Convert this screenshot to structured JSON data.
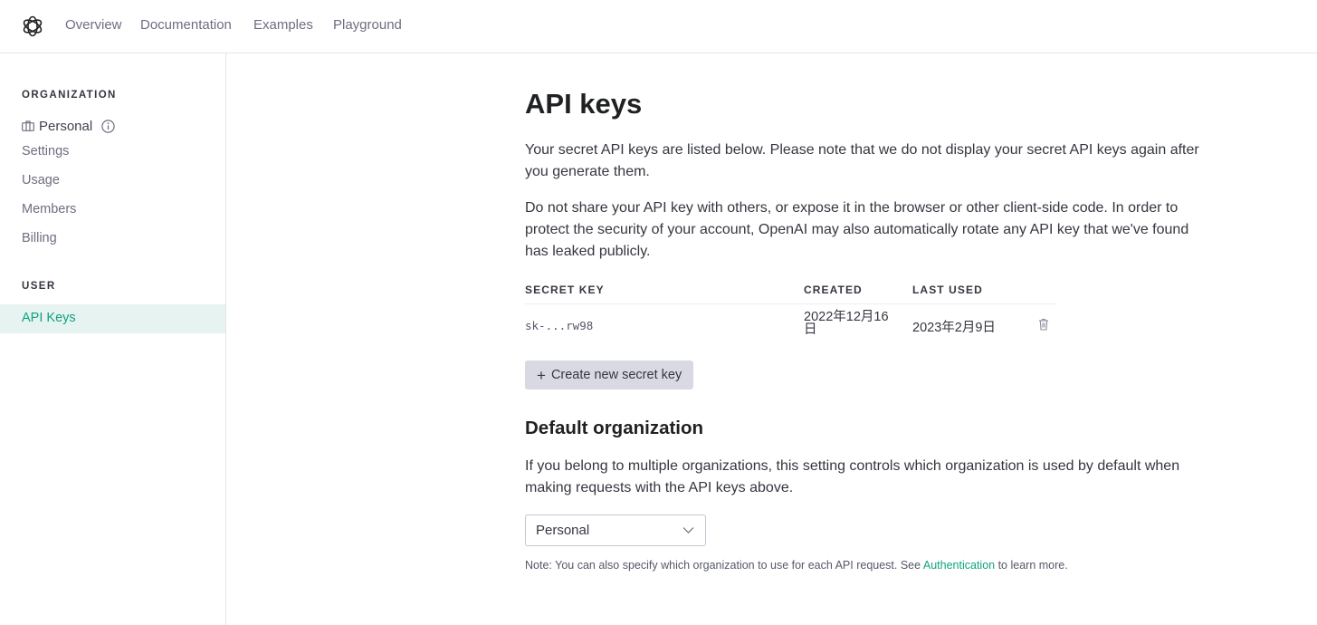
{
  "nav": {
    "links": [
      "Overview",
      "Documentation",
      "Examples",
      "Playground"
    ]
  },
  "sidebar": {
    "organization_title": "ORGANIZATION",
    "org_name": "Personal",
    "org_items": [
      "Settings",
      "Usage",
      "Members",
      "Billing"
    ],
    "user_title": "USER",
    "active_item": "API Keys"
  },
  "main": {
    "title": "API keys",
    "intro_1": "Your secret API keys are listed below. Please note that we do not display your secret API keys again after you generate them.",
    "intro_2": "Do not share your API key with others, or expose it in the browser or other client-side code. In order to protect the security of your account, OpenAI may also automatically rotate any API key that we've found has leaked publicly.",
    "table": {
      "headers": [
        "SECRET KEY",
        "CREATED",
        "LAST USED"
      ],
      "rows": [
        {
          "key": "sk-...rw98",
          "created_1": "2022年12月16",
          "created_2": "日",
          "last_used": "2023年2月9日"
        }
      ]
    },
    "create_button": "Create new secret key",
    "default_org_title": "Default organization",
    "default_org_desc": "If you belong to multiple organizations, this setting controls which organization is used by default when making requests with the API keys above.",
    "org_select_value": "Personal",
    "note_prefix": "Note: You can also specify which organization to use for each API request. See ",
    "note_link": "Authentication",
    "note_suffix": " to learn more."
  },
  "colors": {
    "accent": "#10a37f",
    "active_bg": "#e6f3f1",
    "button_bg": "#d9d9e3"
  }
}
